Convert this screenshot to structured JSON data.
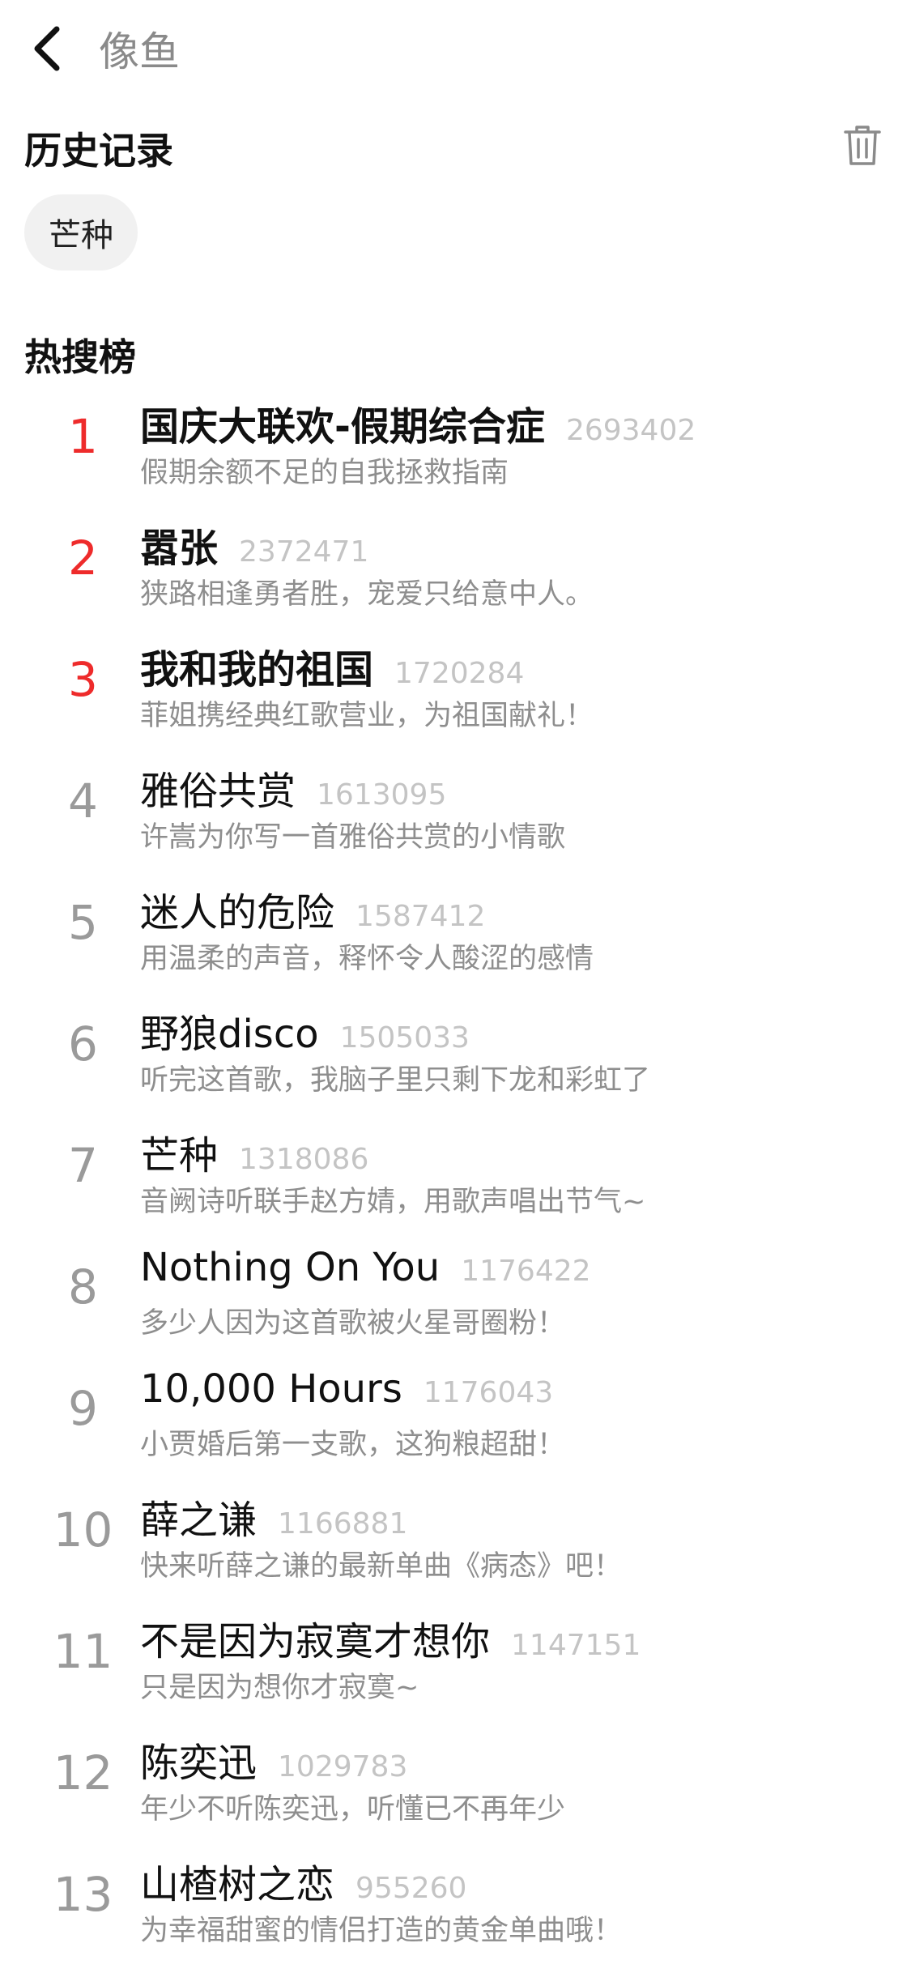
{
  "header": {
    "back_icon": "chevron-left-icon",
    "search_value": "像鱼"
  },
  "history": {
    "title": "历史记录",
    "clear_icon": "trash-icon",
    "items": [
      "芒种"
    ]
  },
  "hot": {
    "title": "热搜榜",
    "accent_color": "#ee2b2b",
    "items": [
      {
        "rank": "1",
        "title": "国庆大联欢-假期综合症",
        "count": "2693402",
        "desc": "假期余额不足的自我拯救指南"
      },
      {
        "rank": "2",
        "title": "嚣张",
        "count": "2372471",
        "desc": "狭路相逢勇者胜，宠爱只给意中人。"
      },
      {
        "rank": "3",
        "title": "我和我的祖国",
        "count": "1720284",
        "desc": "菲姐携经典红歌营业，为祖国献礼！"
      },
      {
        "rank": "4",
        "title": "雅俗共赏",
        "count": "1613095",
        "desc": "许嵩为你写一首雅俗共赏的小情歌"
      },
      {
        "rank": "5",
        "title": "迷人的危险",
        "count": "1587412",
        "desc": "用温柔的声音，释怀令人酸涩的感情"
      },
      {
        "rank": "6",
        "title": "野狼disco",
        "count": "1505033",
        "desc": "听完这首歌，我脑子里只剩下龙和彩虹了"
      },
      {
        "rank": "7",
        "title": "芒种",
        "count": "1318086",
        "desc": "音阙诗听联手赵方婧，用歌声唱出节气~"
      },
      {
        "rank": "8",
        "title": "Nothing On You",
        "count": "1176422",
        "desc": "多少人因为这首歌被火星哥圈粉！"
      },
      {
        "rank": "9",
        "title": "10,000 Hours",
        "count": "1176043",
        "desc": "小贾婚后第一支歌，这狗粮超甜！"
      },
      {
        "rank": "10",
        "title": "薛之谦",
        "count": "1166881",
        "desc": "快来听薛之谦的最新单曲《病态》吧！"
      },
      {
        "rank": "11",
        "title": "不是因为寂寞才想你",
        "count": "1147151",
        "desc": "只是因为想你才寂寞~"
      },
      {
        "rank": "12",
        "title": "陈奕迅",
        "count": "1029783",
        "desc": "年少不听陈奕迅，听懂已不再年少"
      },
      {
        "rank": "13",
        "title": "山楂树之恋",
        "count": "955260",
        "desc": "为幸福甜蜜的情侣打造的黄金单曲哦！"
      }
    ]
  }
}
